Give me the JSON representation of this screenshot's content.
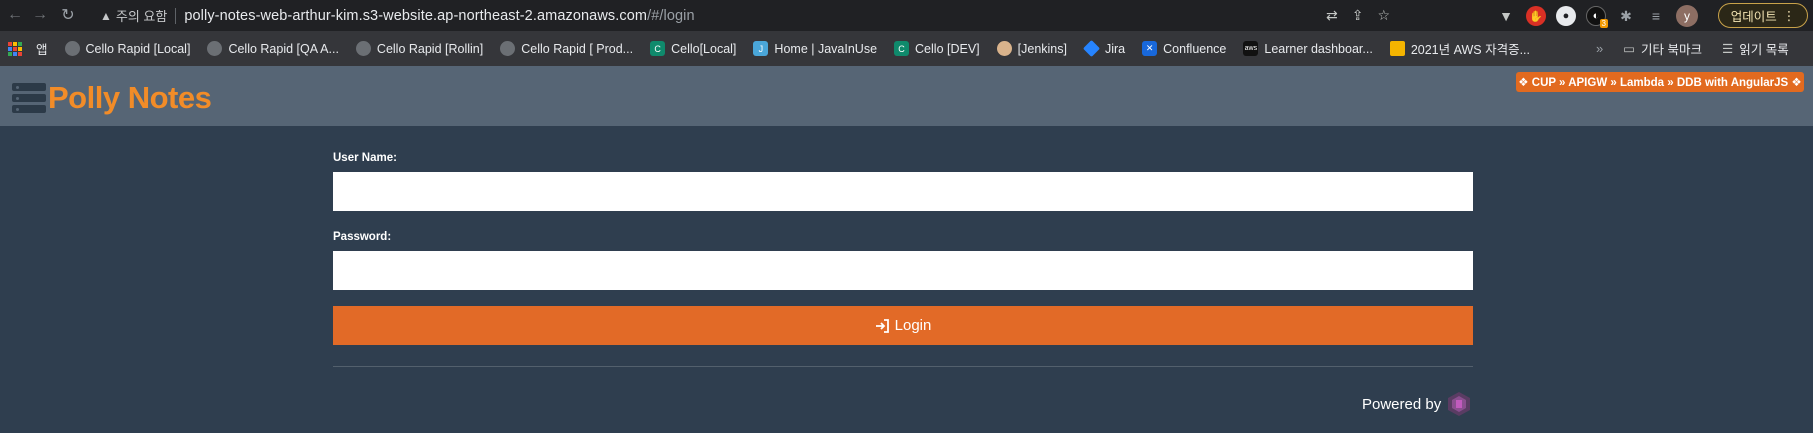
{
  "browser": {
    "security_label": "주의 요함",
    "url_host": "polly-notes-web-arthur-kim.s3-website.ap-northeast-2.amazonaws.com",
    "url_path": "/#/login",
    "update_label": "업데이트",
    "avatar_letter": "y",
    "ext_badge": "3"
  },
  "bookmarks": {
    "apps_label": "앱",
    "items": [
      {
        "label": "Cello Rapid [Local]",
        "icon": "globe-icon"
      },
      {
        "label": "Cello Rapid [QA A...",
        "icon": "globe-icon"
      },
      {
        "label": "Cello Rapid [Rollin]",
        "icon": "globe-icon"
      },
      {
        "label": "Cello Rapid [ Prod...",
        "icon": "globe-icon"
      },
      {
        "label": "Cello[Local]",
        "icon": "cello-icon"
      },
      {
        "label": "Home | JavaInUse",
        "icon": "javainuse-icon"
      },
      {
        "label": "Cello [DEV]",
        "icon": "cello-icon"
      },
      {
        "label": "[Jenkins]",
        "icon": "jenkins-icon"
      },
      {
        "label": "Jira",
        "icon": "jira-icon"
      },
      {
        "label": "Confluence",
        "icon": "confluence-icon"
      },
      {
        "label": "Learner dashboar...",
        "icon": "aws-icon"
      },
      {
        "label": "2021년 AWS 자격증...",
        "icon": "folder-icon"
      }
    ],
    "other_label": "기타 북마크",
    "reading_list_label": "읽기 목록"
  },
  "app": {
    "title": "Polly Notes",
    "stack_badge": "❖ CUP » APIGW » Lambda » DDB with AngularJS ❖",
    "colors": {
      "brand": "#f28c28",
      "button": "#e26a27",
      "header_bg": "#566575",
      "page_bg": "#2f3e4f"
    }
  },
  "login": {
    "username_label": "User Name:",
    "username_value": "",
    "password_label": "Password:",
    "password_value": "",
    "button_label": "Login",
    "powered_by": "Powered by"
  }
}
